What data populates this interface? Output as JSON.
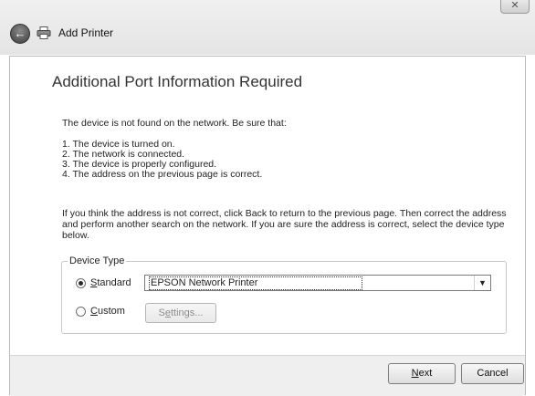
{
  "window": {
    "title": "Add Printer",
    "close_glyph": "✕",
    "back_glyph": "←"
  },
  "page": {
    "heading": "Additional Port Information Required",
    "intro": "The device is not found on the network.  Be sure that:",
    "checklist": [
      "1.  The device is turned on.",
      "2.  The network is connected.",
      "3.  The device is properly configured.",
      "4.  The address on the previous page is correct."
    ],
    "instructions": "If you think the address is not correct, click Back to return to the previous page.  Then correct the address and perform another search on the network.  If you are sure the address is correct, select the device type below."
  },
  "device_type": {
    "legend": "Device Type",
    "standard": {
      "mnemonic": "S",
      "rest": "tandard",
      "checked": true
    },
    "custom": {
      "mnemonic": "C",
      "rest": "ustom",
      "checked": false
    },
    "select_value": "EPSON Network Printer",
    "settings": {
      "before": "S",
      "mnemonic": "e",
      "after": "ttings..."
    }
  },
  "footer": {
    "next": {
      "mnemonic": "N",
      "rest": "ext"
    },
    "cancel": "Cancel"
  },
  "icons": [
    "back-arrow-icon",
    "printer-icon",
    "close-icon",
    "dropdown-arrow-icon"
  ]
}
